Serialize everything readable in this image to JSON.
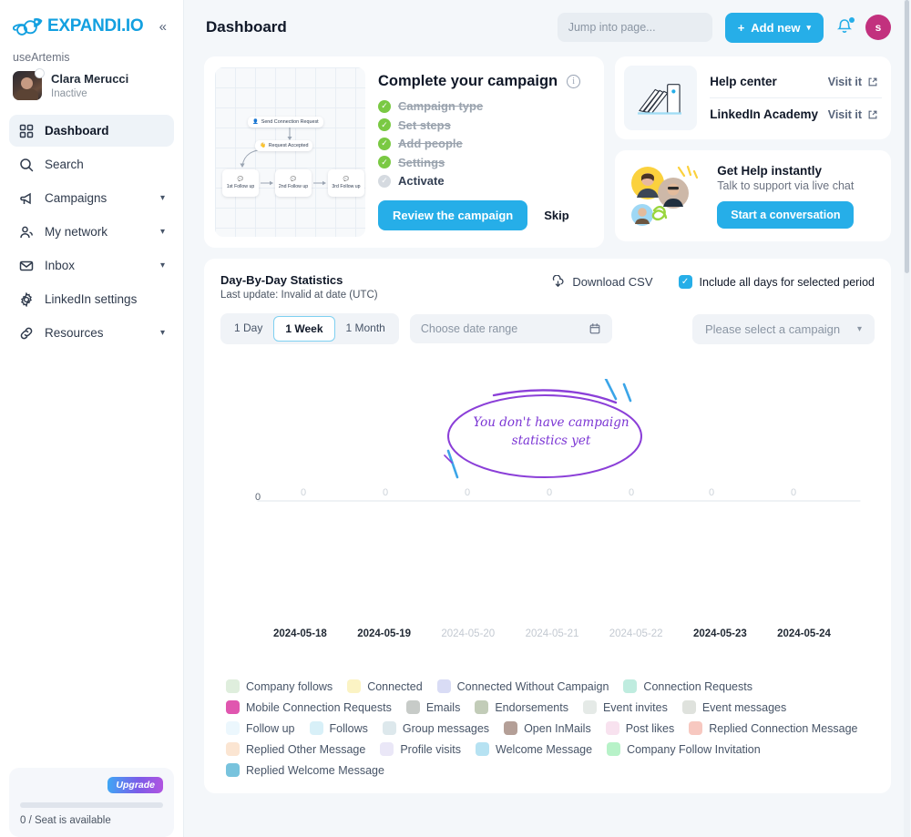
{
  "sidebar": {
    "logo_text": "EXPANDI.IO",
    "collapse_icon": "chevrons-left-icon",
    "workspace": "useArtemis",
    "profile": {
      "name": "Clara Merucci",
      "status": "Inactive"
    },
    "items": [
      {
        "label": "Dashboard",
        "icon": "grid-icon",
        "active": true,
        "chevron": false
      },
      {
        "label": "Search",
        "icon": "search-icon",
        "active": false,
        "chevron": false
      },
      {
        "label": "Campaigns",
        "icon": "megaphone-icon",
        "active": false,
        "chevron": true
      },
      {
        "label": "My network",
        "icon": "people-icon",
        "active": false,
        "chevron": true
      },
      {
        "label": "Inbox",
        "icon": "envelope-icon",
        "active": false,
        "chevron": true
      },
      {
        "label": "LinkedIn settings",
        "icon": "gear-icon",
        "active": false,
        "chevron": false
      },
      {
        "label": "Resources",
        "icon": "link-icon",
        "active": false,
        "chevron": true
      }
    ],
    "seat": {
      "upgrade_label": "Upgrade",
      "seat_text": "0 / Seat is available"
    }
  },
  "topbar": {
    "title": "Dashboard",
    "search_placeholder": "Jump into page...",
    "add_new_label": "Add new",
    "bell_icon": "bell-icon",
    "avatar_initial": "s"
  },
  "campaign_card": {
    "title": "Complete your campaign",
    "info_icon": "info-icon",
    "flow": {
      "step1": "Send Connection Request",
      "step2": "Request Accepted",
      "followups": [
        "1st Follow up",
        "2nd Follow up",
        "3rd Follow up"
      ]
    },
    "steps": [
      {
        "label": "Campaign type",
        "done": true
      },
      {
        "label": "Set steps",
        "done": true
      },
      {
        "label": "Add people",
        "done": true
      },
      {
        "label": "Settings",
        "done": true
      },
      {
        "label": "Activate",
        "done": false
      }
    ],
    "primary_label": "Review the campaign",
    "skip_label": "Skip"
  },
  "help_card": {
    "links": [
      {
        "title": "Help center",
        "action": "Visit it"
      },
      {
        "title": "LinkedIn Academy",
        "action": "Visit it"
      }
    ],
    "external_icon": "external-link-icon"
  },
  "chat_card": {
    "title": "Get Help instantly",
    "subtitle": "Talk to support via live chat",
    "button_label": "Start a conversation"
  },
  "stats": {
    "title": "Day-By-Day Statistics",
    "subtitle": "Last update: Invalid at date (UTC)",
    "download_label": "Download CSV",
    "download_icon": "download-icon",
    "include_all_label": "Include all days for selected period",
    "include_all_checked": true,
    "ranges": [
      {
        "label": "1 Day",
        "active": false
      },
      {
        "label": "1 Week",
        "active": true
      },
      {
        "label": "1 Month",
        "active": false
      }
    ],
    "date_placeholder": "Choose date range",
    "calendar_icon": "calendar-icon",
    "campaign_placeholder": "Please select a campaign",
    "chevron_icon": "chevron-down-icon",
    "empty_message_line1": "You don't have campaign",
    "empty_message_line2": "statistics yet"
  },
  "chart_data": {
    "type": "bar",
    "title": "Day-By-Day Statistics",
    "xlabel": "",
    "ylabel": "",
    "ylim": [
      0,
      0
    ],
    "grid": true,
    "legend_position": "bottom",
    "axis_zero_label": "0",
    "categories": [
      "2024-05-18",
      "2024-05-19",
      "2024-05-20",
      "2024-05-21",
      "2024-05-22",
      "2024-05-23",
      "2024-05-24"
    ],
    "category_dim": [
      false,
      false,
      true,
      true,
      true,
      false,
      false
    ],
    "point_labels": [
      "0",
      "0",
      "0",
      "0",
      "0",
      "0",
      "0"
    ],
    "values": [
      0,
      0,
      0,
      0,
      0,
      0,
      0
    ],
    "series": [
      {
        "name": "Company follows",
        "color": "#dfeedd",
        "values": [
          0,
          0,
          0,
          0,
          0,
          0,
          0
        ]
      },
      {
        "name": "Connected",
        "color": "#fbf3c4",
        "values": [
          0,
          0,
          0,
          0,
          0,
          0,
          0
        ]
      },
      {
        "name": "Connected Without Campaign",
        "color": "#d9dcf5",
        "values": [
          0,
          0,
          0,
          0,
          0,
          0,
          0
        ]
      },
      {
        "name": "Connection Requests",
        "color": "#bfecdf",
        "values": [
          0,
          0,
          0,
          0,
          0,
          0,
          0
        ]
      },
      {
        "name": "Mobile Connection Requests",
        "color": "#e056af",
        "values": [
          0,
          0,
          0,
          0,
          0,
          0,
          0
        ]
      },
      {
        "name": "Emails",
        "color": "#c7cbc8",
        "values": [
          0,
          0,
          0,
          0,
          0,
          0,
          0
        ]
      },
      {
        "name": "Endorsements",
        "color": "#c2ccb8",
        "values": [
          0,
          0,
          0,
          0,
          0,
          0,
          0
        ]
      },
      {
        "name": "Event invites",
        "color": "#e5eae7",
        "values": [
          0,
          0,
          0,
          0,
          0,
          0,
          0
        ]
      },
      {
        "name": "Event messages",
        "color": "#dfe2dd",
        "values": [
          0,
          0,
          0,
          0,
          0,
          0,
          0
        ]
      },
      {
        "name": "Follow up",
        "color": "#ecf7fd",
        "values": [
          0,
          0,
          0,
          0,
          0,
          0,
          0
        ]
      },
      {
        "name": "Follows",
        "color": "#d8f0f8",
        "values": [
          0,
          0,
          0,
          0,
          0,
          0,
          0
        ]
      },
      {
        "name": "Group messages",
        "color": "#dde8ec",
        "values": [
          0,
          0,
          0,
          0,
          0,
          0,
          0
        ]
      },
      {
        "name": "Open InMails",
        "color": "#b49f97",
        "values": [
          0,
          0,
          0,
          0,
          0,
          0,
          0
        ]
      },
      {
        "name": "Post likes",
        "color": "#f8e2ef",
        "values": [
          0,
          0,
          0,
          0,
          0,
          0,
          0
        ]
      },
      {
        "name": "Replied Connection Message",
        "color": "#f7c8c0",
        "values": [
          0,
          0,
          0,
          0,
          0,
          0,
          0
        ]
      },
      {
        "name": "Replied Other Message",
        "color": "#fbe5d2",
        "values": [
          0,
          0,
          0,
          0,
          0,
          0,
          0
        ]
      },
      {
        "name": "Profile visits",
        "color": "#eae7f7",
        "values": [
          0,
          0,
          0,
          0,
          0,
          0,
          0
        ]
      },
      {
        "name": "Welcome Message",
        "color": "#b6e2f2",
        "values": [
          0,
          0,
          0,
          0,
          0,
          0,
          0
        ]
      },
      {
        "name": "Company Follow Invitation",
        "color": "#b7f2c8",
        "values": [
          0,
          0,
          0,
          0,
          0,
          0,
          0
        ]
      },
      {
        "name": "Replied Welcome Message",
        "color": "#78c3dd",
        "values": [
          0,
          0,
          0,
          0,
          0,
          0,
          0
        ]
      }
    ]
  },
  "colors": {
    "accent": "#26aee8",
    "sidebar_bg": "#ffffff",
    "page_bg": "#f4f7fa",
    "avatar_bg": "#c2317e",
    "empty_state": "#7b35d4",
    "tick_green": "#7ac943"
  }
}
